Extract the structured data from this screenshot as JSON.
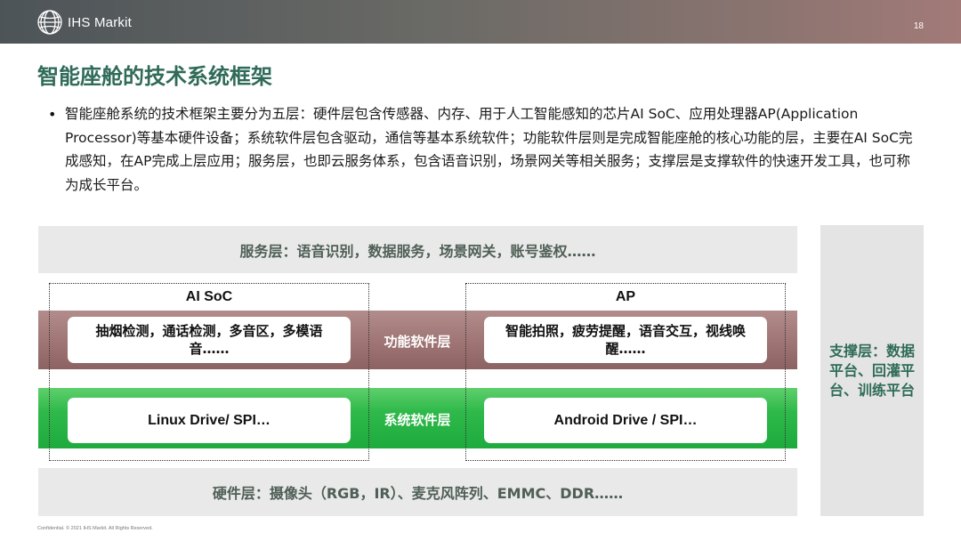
{
  "header": {
    "logo_text": "IHS Markit",
    "page_number": "18",
    "logo_icon": "ihs-markit-globe-icon"
  },
  "title": "智能座舱的技术系统框架",
  "bullet_symbol": "•",
  "paragraph": "智能座舱系统的技术框架主要分为五层：硬件层包含传感器、内存、用于人工智能感知的芯片AI SoC、应用处理器AP(Application Processor)等基本硬件设备；系统软件层包含驱动，通信等基本系统软件；功能软件层则是完成智能座舱的核心功能的层，主要在AI SoC完成感知，在AP完成上层应用；服务层，也即云服务体系，包含语音识别，场景网关等相关服务；支撑层是支撑软件的快速开发工具，也可称为成长平台。",
  "diagram": {
    "service_layer": "服务层：语音识别，数据服务，场景网关，账号鉴权……",
    "hardware_layer": "硬件层：摄像头（RGB，IR）、麦克风阵列、EMMC、DDR……",
    "support_layer": "支撑层：数据平台、回灌平台、训练平台",
    "func_layer_label": "功能软件层",
    "sys_layer_label": "系统软件层",
    "ai_soc": {
      "title": "AI SoC",
      "func_box": "抽烟检测，通话检测，多音区，多模语音……",
      "sys_box": "Linux Drive/ SPI…"
    },
    "ap": {
      "title": "AP",
      "func_box": "智能拍照，疲劳提醒，语音交互，视线唤醒……",
      "sys_box": "Android Drive / SPI…"
    },
    "colors": {
      "func_layer": "#9f7474",
      "sys_layer": "#2eb94a",
      "gray_layer": "#e9e9e9",
      "title_green": "#2f6b58"
    }
  },
  "footer": "Confidential. © 2021 IHS Markit. All Rights Reserved."
}
